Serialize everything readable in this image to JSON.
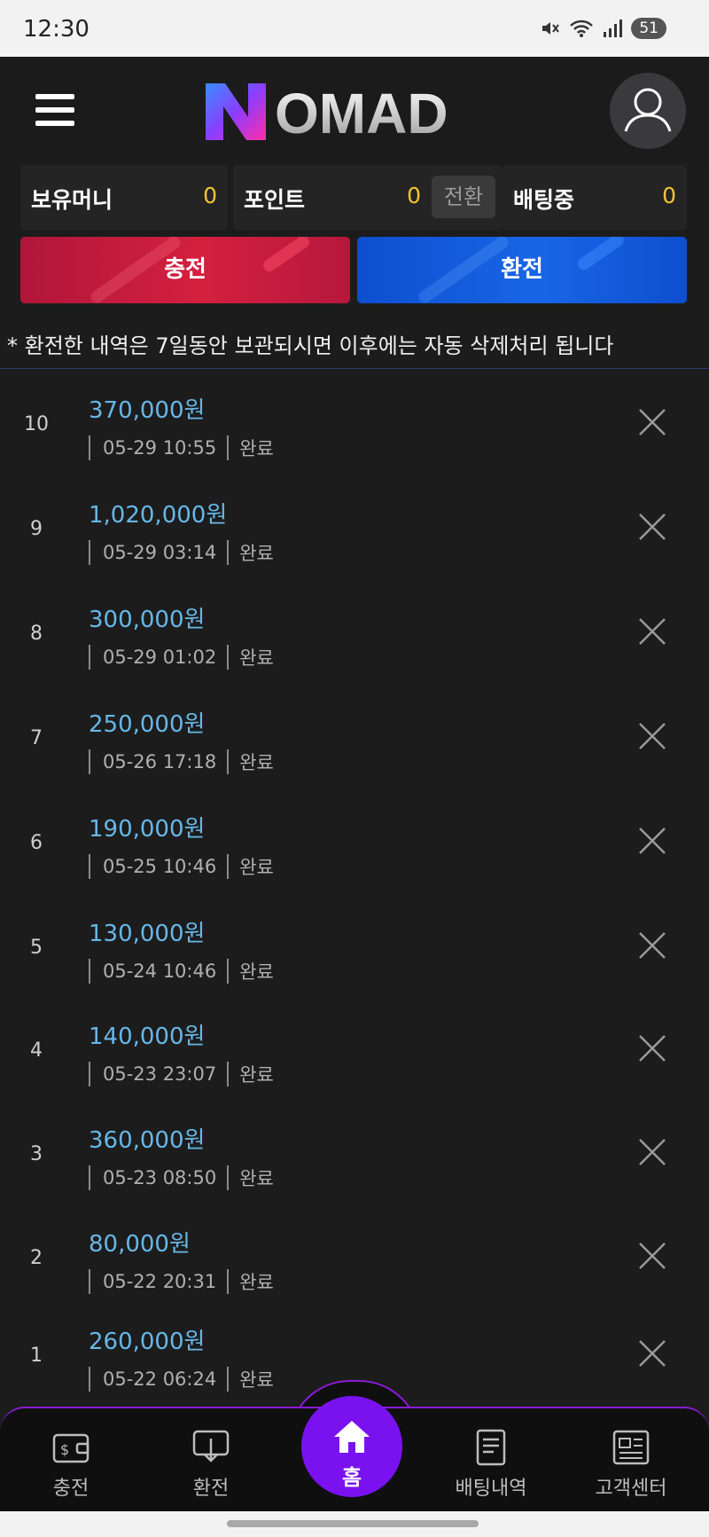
{
  "status": {
    "time": "12:30",
    "battery": "51"
  },
  "header": {
    "logo_text": "OMAD"
  },
  "balances": {
    "money": {
      "label": "보유머니",
      "value": "0"
    },
    "point": {
      "label": "포인트",
      "value": "0",
      "convert": "전환"
    },
    "betting": {
      "label": "배팅중",
      "value": "0"
    }
  },
  "actions": {
    "charge": "충전",
    "exchange": "환전"
  },
  "notice": "* 환전한 내역은 7일동안 보관되시면 이후에는 자동 삭제처리 됩니다",
  "rows": [
    {
      "idx": "10",
      "amount": "370,000원",
      "datetime": "05-29 10:55",
      "status": "완료"
    },
    {
      "idx": "9",
      "amount": "1,020,000원",
      "datetime": "05-29 03:14",
      "status": "완료"
    },
    {
      "idx": "8",
      "amount": "300,000원",
      "datetime": "05-29 01:02",
      "status": "완료"
    },
    {
      "idx": "7",
      "amount": "250,000원",
      "datetime": "05-26 17:18",
      "status": "완료"
    },
    {
      "idx": "6",
      "amount": "190,000원",
      "datetime": "05-25 10:46",
      "status": "완료"
    },
    {
      "idx": "5",
      "amount": "130,000원",
      "datetime": "05-24 10:46",
      "status": "완료"
    },
    {
      "idx": "4",
      "amount": "140,000원",
      "datetime": "05-23 23:07",
      "status": "완료"
    },
    {
      "idx": "3",
      "amount": "360,000원",
      "datetime": "05-23 08:50",
      "status": "완료"
    },
    {
      "idx": "2",
      "amount": "80,000원",
      "datetime": "05-22 20:31",
      "status": "완료"
    },
    {
      "idx": "1",
      "amount": "260,000원",
      "datetime": "05-22 06:24",
      "status": "완료"
    }
  ],
  "nav": {
    "charge": "충전",
    "exchange": "환전",
    "home": "홈",
    "bet_history": "배팅내역",
    "support": "고객센터"
  },
  "colors": {
    "amount": "#67b7e6",
    "balance_value": "#f4c430",
    "accent": "#7a12f0",
    "charge": "#c81c3d",
    "exchange": "#1259dc"
  }
}
